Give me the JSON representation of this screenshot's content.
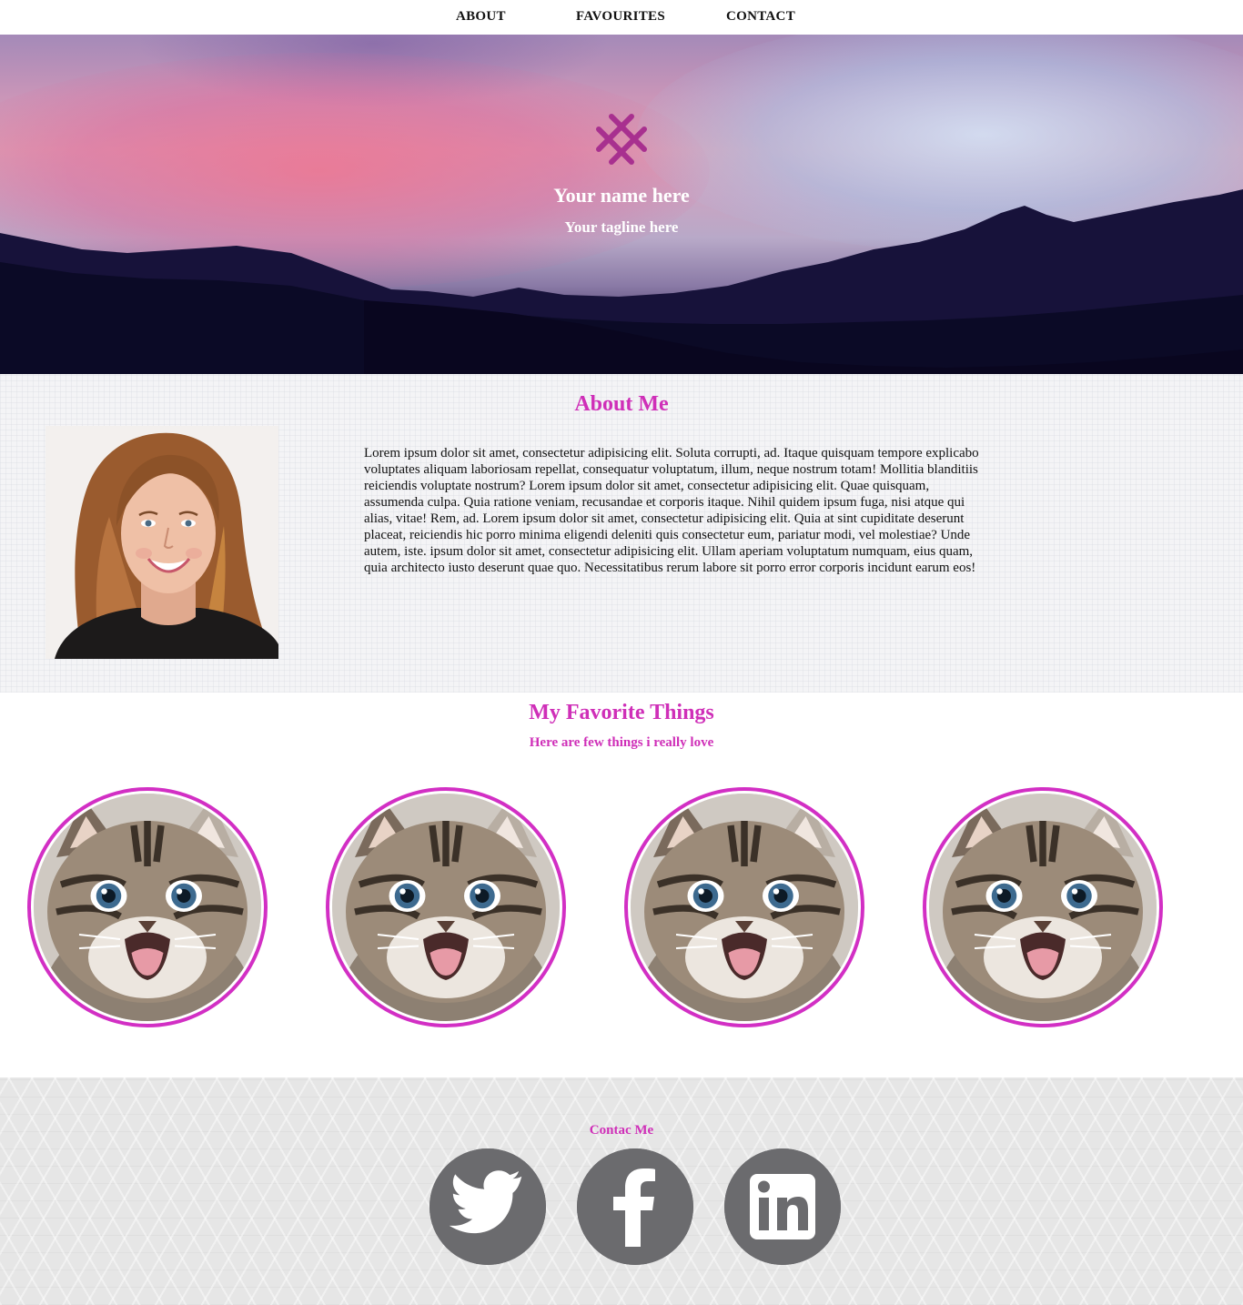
{
  "nav": {
    "items": [
      {
        "label": "ABOUT"
      },
      {
        "label": "FAVOURITES"
      },
      {
        "label": "CONTACT"
      }
    ]
  },
  "hero": {
    "logo_icon": "crosshatch-logo-icon",
    "name": "Your name here",
    "tagline": "Your tagline here"
  },
  "about": {
    "title": "About Me",
    "body": "Lorem ipsum dolor sit amet, consectetur adipisicing elit. Soluta corrupti, ad. Itaque quisquam tempore explicabo voluptates aliquam laboriosam repellat, consequatur voluptatum, illum, neque nostrum totam! Mollitia blanditiis reiciendis voluptate nostrum? Lorem ipsum dolor sit amet, consectetur adipisicing elit. Quae quisquam, assumenda culpa. Quia ratione veniam, recusandae et corporis itaque. Nihil quidem ipsum fuga, nisi atque qui alias, vitae! Rem, ad. Lorem ipsum dolor sit amet, consectetur adipisicing elit. Quia at sint cupiditate deserunt placeat, reiciendis hic porro minima eligendi deleniti quis consectetur eum, pariatur modi, vel molestiae? Unde autem, iste. ipsum dolor sit amet, consectetur adipisicing elit. Ullam aperiam voluptatum numquam, eius quam, quia architecto iusto deserunt quae quo. Necessitatibus rerum labore sit porro error corporis incidunt earum eos!"
  },
  "favorites": {
    "title": "My Favorite Things",
    "subtitle": "Here are few things i really love",
    "items": [
      {
        "image": "kitten"
      },
      {
        "image": "kitten"
      },
      {
        "image": "kitten"
      },
      {
        "image": "kitten"
      }
    ]
  },
  "footer": {
    "title": "Contac Me",
    "social": [
      {
        "icon": "twitter-icon"
      },
      {
        "icon": "facebook-icon"
      },
      {
        "icon": "linkedin-icon"
      }
    ]
  },
  "colors": {
    "accent": "#cf2fb8",
    "social_icon_bg": "#6b6b6e",
    "footer_bg": "#e6e6e6"
  }
}
